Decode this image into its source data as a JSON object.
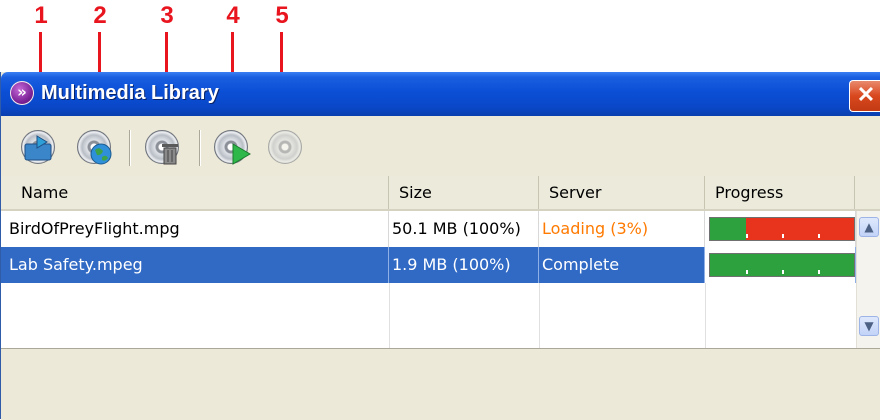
{
  "callouts": [
    "1",
    "2",
    "3",
    "4",
    "5"
  ],
  "window": {
    "title": "Multimedia Library",
    "close_glyph": "✕"
  },
  "toolbar": {
    "buttons": [
      {
        "icon": "import-disc-icon"
      },
      {
        "icon": "network-disc-icon"
      },
      {
        "icon": "delete-disc-icon"
      },
      {
        "icon": "play-disc-icon"
      },
      {
        "icon": "disc-disabled-icon"
      }
    ]
  },
  "table": {
    "columns": [
      "Name",
      "Size",
      "Server",
      "Progress"
    ],
    "rows": [
      {
        "name": "BirdOfPreyFlight.mpg",
        "size": "50.1 MB (100%)",
        "server": "Loading (3%)",
        "progress": 0.25,
        "selected": false
      },
      {
        "name": "Lab Safety.mpeg",
        "size": "1.9 MB (100%)",
        "server": "Complete",
        "progress": 1.0,
        "selected": true
      }
    ]
  },
  "scrollbar": {
    "up": "▲",
    "down": "▼"
  },
  "colors": {
    "callout": "#e8141e",
    "loading_text": "#ff7a00",
    "selection": "#316ac5",
    "progress_done": "#2da13d",
    "progress_pending": "#e8341c",
    "titlebar": "#0b4fd6"
  }
}
